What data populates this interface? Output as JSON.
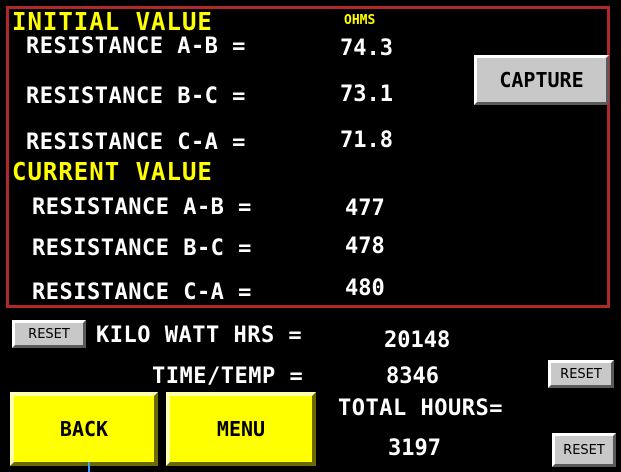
{
  "initial": {
    "header": "INITIAL VALUE",
    "units": "OHMS",
    "rows": [
      {
        "label": "RESISTANCE A-B =",
        "value": "74.3"
      },
      {
        "label": "RESISTANCE B-C =",
        "value": "73.1"
      },
      {
        "label": "RESISTANCE C-A =",
        "value": "71.8"
      }
    ]
  },
  "current": {
    "header": "CURRENT VALUE",
    "rows": [
      {
        "label": "RESISTANCE A-B =",
        "value": "477"
      },
      {
        "label": "RESISTANCE B-C =",
        "value": "478"
      },
      {
        "label": "RESISTANCE C-A =",
        "value": "480"
      }
    ]
  },
  "buttons": {
    "capture": "CAPTURE",
    "reset": "RESET",
    "back": "BACK",
    "menu": "MENU"
  },
  "bottom": {
    "kwh_label": "KILO WATT HRS =",
    "kwh_value": "20148",
    "timetemp_label": "TIME/TEMP =",
    "timetemp_value": "8346",
    "total_hours_label": "TOTAL HOURS=",
    "total_hours_value": "3197"
  },
  "colors": {
    "header": "#ffff00",
    "text": "#ffffff",
    "panel_border": "#b0282a",
    "button_yellow": "#ffff00",
    "button_gray": "#c8c8c8"
  }
}
